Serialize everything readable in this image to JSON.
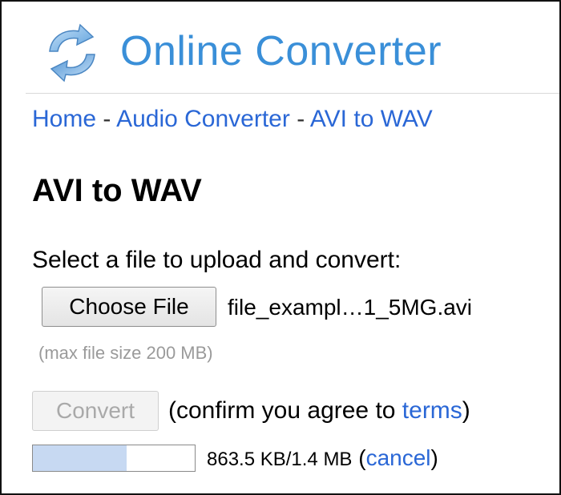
{
  "header": {
    "site_title": "Online Converter",
    "logo_icon": "refresh-arrows-icon"
  },
  "breadcrumb": {
    "items": [
      "Home",
      "Audio Converter",
      "AVI to WAV"
    ],
    "separator": "-"
  },
  "page_title": "AVI to WAV",
  "upload": {
    "instructions": "Select a file to upload and convert:",
    "choose_button_label": "Choose File",
    "selected_file": "file_exampl…1_5MG.avi",
    "max_size_note": "(max file size 200 MB)"
  },
  "convert": {
    "button_label": "Convert",
    "confirm_prefix": "(confirm you agree to ",
    "terms_label": "terms",
    "confirm_suffix": ")"
  },
  "progress": {
    "fraction": 0.58,
    "size_text": "863.5 KB/1.4 MB",
    "open_paren": "(",
    "cancel_label": "cancel",
    "close_paren": ")"
  },
  "colors": {
    "brand_blue": "#3a8fd8",
    "link_blue": "#2a67d6",
    "progress_fill": "#c7d9f2"
  }
}
